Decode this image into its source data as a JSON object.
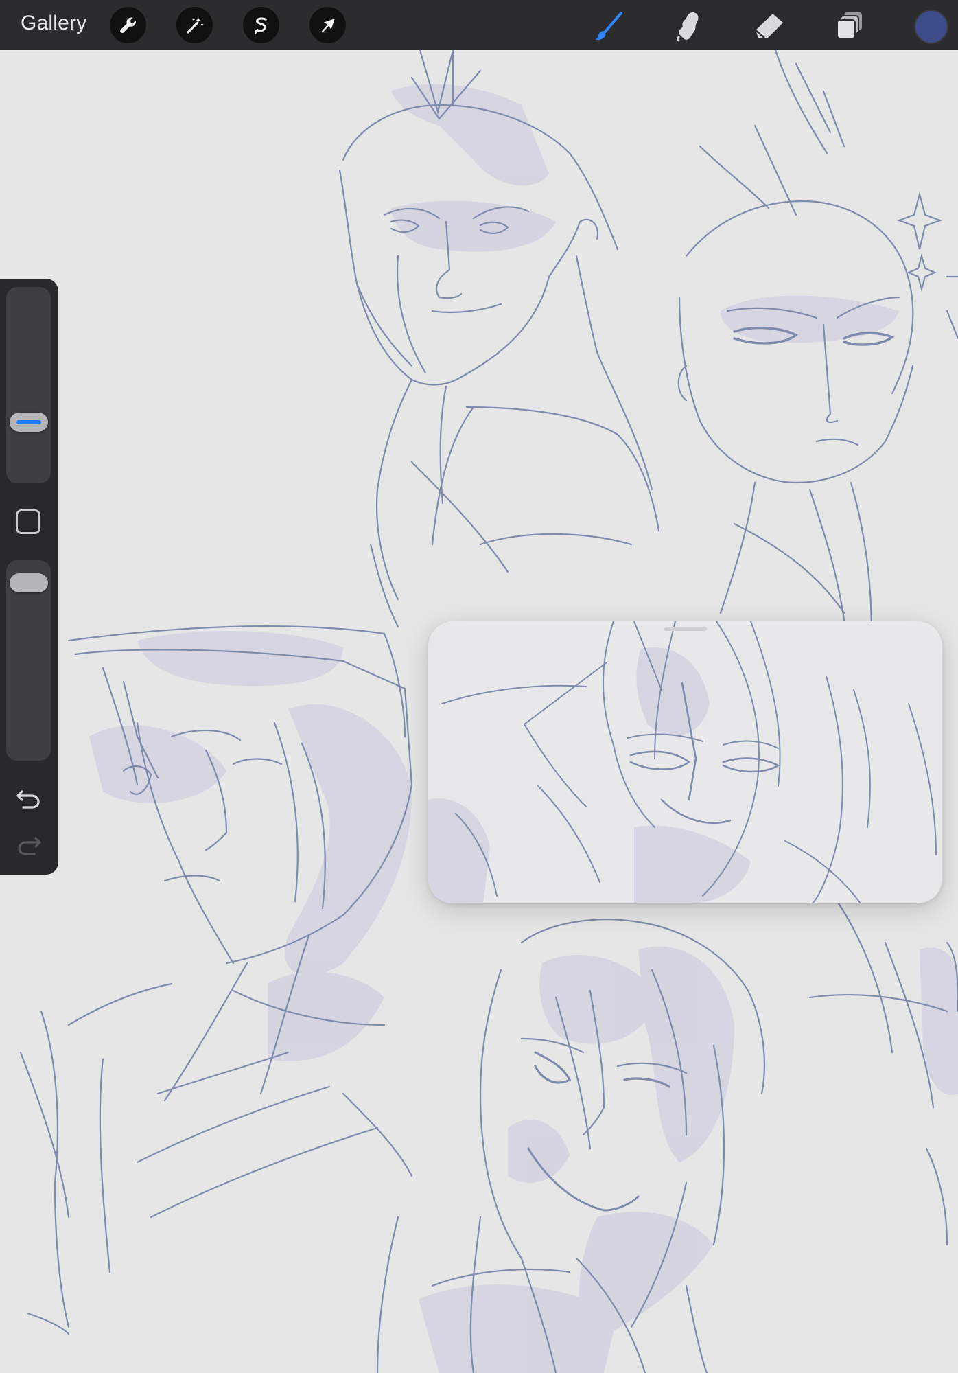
{
  "app": {
    "gallery_label": "Gallery"
  },
  "toolbar": {
    "left_tools": [
      {
        "name": "actions",
        "icon": "wrench-icon"
      },
      {
        "name": "adjustments",
        "icon": "magic-wand-icon"
      },
      {
        "name": "selection",
        "icon": "selection-s-icon"
      },
      {
        "name": "transform",
        "icon": "arrow-cursor-icon"
      }
    ],
    "right_tools": [
      {
        "name": "brush",
        "icon": "brush-icon",
        "active": true
      },
      {
        "name": "smudge",
        "icon": "smudge-finger-icon",
        "active": false
      },
      {
        "name": "eraser",
        "icon": "eraser-icon",
        "active": false
      },
      {
        "name": "layers",
        "icon": "layers-icon",
        "active": false
      }
    ],
    "active_color": "#3c4d8a"
  },
  "sidebar": {
    "brush_size_level": 0.28,
    "opacity_level": 0.95,
    "controls": [
      "brush-size-slider",
      "modify-button",
      "opacity-slider",
      "undo-button",
      "redo-button"
    ]
  },
  "colors": {
    "canvas": "#e6e6e7",
    "sketch_line": "#7f8bad",
    "shadow_tint": "#d3cfe0",
    "toolbar": "#2c2c2e",
    "accent": "#1e7bff"
  },
  "reference_window": {
    "visible": true
  }
}
